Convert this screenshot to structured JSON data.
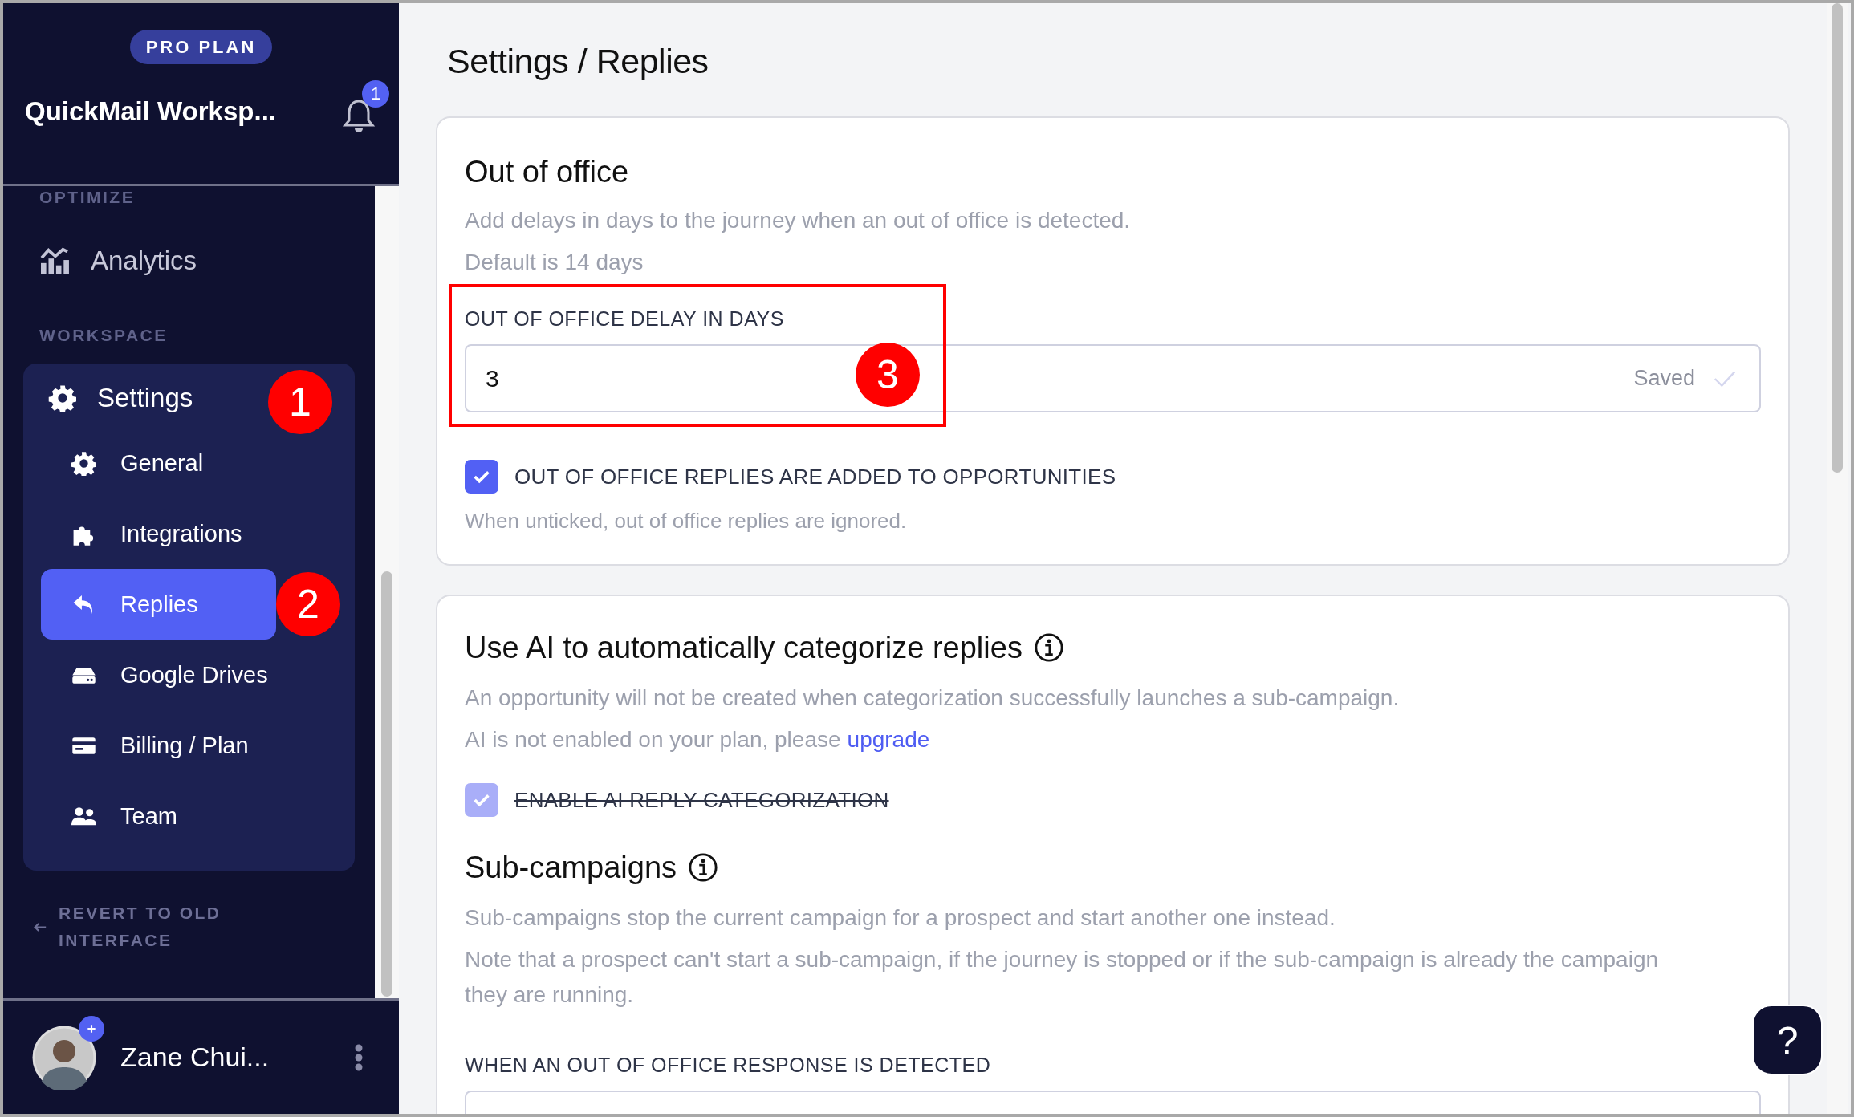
{
  "sidebar": {
    "plan_badge": "PRO PLAN",
    "workspace": "QuickMail Worksp...",
    "notification_count": "1",
    "optimize": {
      "label": "OPTIMIZE",
      "items": [
        {
          "label": "Analytics",
          "selected": false
        }
      ]
    },
    "workspace_section": {
      "label": "WORKSPACE",
      "group": {
        "label": "Settings",
        "callout": "1",
        "children": [
          {
            "label": "General",
            "selected": false
          },
          {
            "label": "Integrations",
            "selected": false
          },
          {
            "label": "Replies",
            "selected": true,
            "callout": "2"
          },
          {
            "label": "Google Drives",
            "selected": false
          },
          {
            "label": "Billing / Plan",
            "selected": false
          },
          {
            "label": "Team",
            "selected": false
          }
        ]
      }
    },
    "revert_link": "REVERT TO OLD INTERFACE",
    "user": {
      "name": "Zane Chui..."
    }
  },
  "page_title": "Settings / Replies",
  "out_of_office": {
    "title": "Out of office",
    "descriptions": [
      "Add delays in days to the journey when an out of office is detected.",
      "Default is 14 days"
    ],
    "field": {
      "label": "OUT OF OFFICE DELAY IN DAYS",
      "value": "3",
      "status": "Saved",
      "callout": "3"
    },
    "checkbox": {
      "label": "OUT OF OFFICE REPLIES ARE ADDED TO OPPORTUNITIES",
      "checked": true,
      "disabled": false
    },
    "hint": "When unticked, out of office replies are ignored."
  },
  "ai": {
    "title": "Use AI to automatically categorize replies",
    "description": "An opportunity will not be created when categorization successfully launches a sub-campaign.",
    "notice": {
      "text": "AI is not enabled on your plan, please",
      "link": "upgrade"
    },
    "checkbox": {
      "label": "ENABLE AI REPLY CATEGORIZATION",
      "checked": true,
      "disabled": true
    },
    "sub_title": "Sub-campaigns",
    "sub_descriptions": [
      "Sub-campaigns stop the current campaign for a prospect and start another one instead.",
      "Note that a prospect can't start a sub-campaign, if the journey is stopped or if the sub-campaign is already the campaign they are running."
    ],
    "field_label": "WHEN AN OUT OF OFFICE RESPONSE IS DETECTED"
  },
  "help_button": "?"
}
